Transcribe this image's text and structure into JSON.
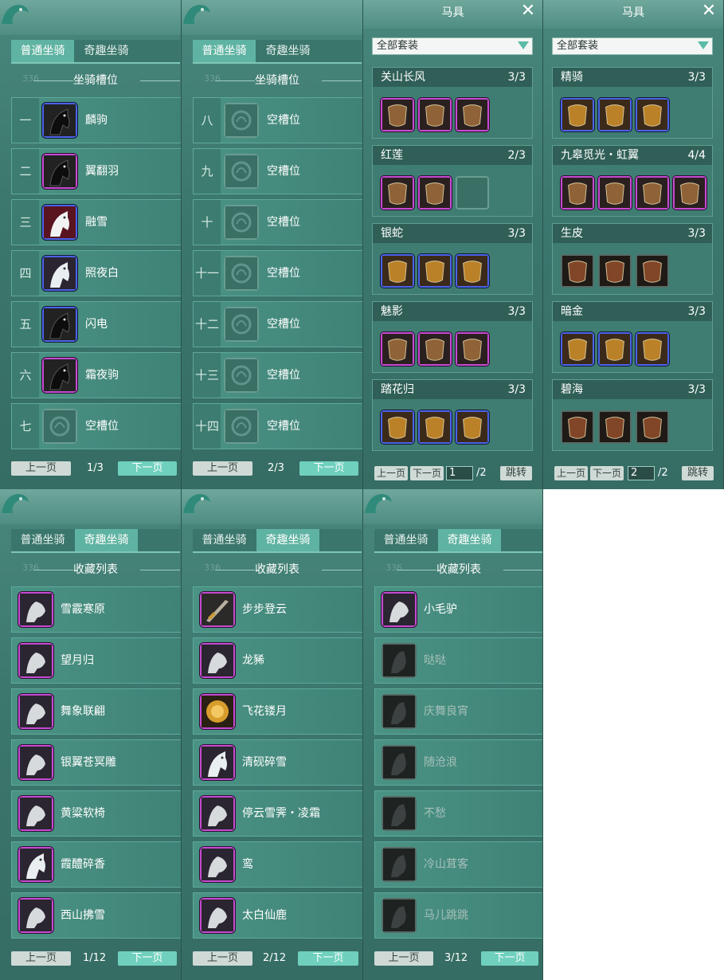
{
  "tabs": {
    "normal": "普通坐骑",
    "fancy": "奇趣坐骑"
  },
  "watermark": "336",
  "slots_section_title": "坐骑槽位",
  "collection_section_title": "收藏列表",
  "pager": {
    "prev": "上一页",
    "next": "下一页"
  },
  "colors": {
    "panel": "#3c786e",
    "tab_active": "#5fb3a2",
    "blue_quality": "#4a63e8",
    "purple_quality": "#c64ad2"
  },
  "slot_panels": [
    {
      "page": "1/3",
      "rows": [
        {
          "idx": "一",
          "name": "麟驹",
          "quality": "blue",
          "icon": "black-horse-icon"
        },
        {
          "idx": "二",
          "name": "翼翻羽",
          "quality": "purple",
          "icon": "black-horse-icon"
        },
        {
          "idx": "三",
          "name": "融雪",
          "quality": "blue",
          "icon": "white-horse-red-icon"
        },
        {
          "idx": "四",
          "name": "照夜白",
          "quality": "blue",
          "icon": "white-horse-icon"
        },
        {
          "idx": "五",
          "name": "闪电",
          "quality": "blue",
          "icon": "black-horse-icon"
        },
        {
          "idx": "六",
          "name": "霜夜驹",
          "quality": "purple",
          "icon": "black-horse-icon"
        },
        {
          "idx": "七",
          "name": "空槽位",
          "quality": "empty",
          "icon": "empty-slot-icon"
        }
      ]
    },
    {
      "page": "2/3",
      "rows": [
        {
          "idx": "八",
          "name": "空槽位",
          "quality": "empty",
          "icon": "empty-slot-icon"
        },
        {
          "idx": "九",
          "name": "空槽位",
          "quality": "empty",
          "icon": "empty-slot-icon"
        },
        {
          "idx": "十",
          "name": "空槽位",
          "quality": "empty",
          "icon": "empty-slot-icon"
        },
        {
          "idx": "十一",
          "name": "空槽位",
          "quality": "empty",
          "icon": "empty-slot-icon"
        },
        {
          "idx": "十二",
          "name": "空槽位",
          "quality": "empty",
          "icon": "empty-slot-icon"
        },
        {
          "idx": "十三",
          "name": "空槽位",
          "quality": "empty",
          "icon": "empty-slot-icon"
        },
        {
          "idx": "十四",
          "name": "空槽位",
          "quality": "empty",
          "icon": "empty-slot-icon"
        }
      ]
    }
  ],
  "gear": {
    "title": "马具",
    "filter": "全部套装",
    "jump": "跳转",
    "panels": [
      {
        "page_input": "1",
        "page_total": "/2",
        "sets": [
          {
            "name": "关山长风",
            "count": "3/3",
            "items": [
              "purple",
              "purple",
              "purple"
            ]
          },
          {
            "name": "红莲",
            "count": "2/3",
            "items": [
              "purple",
              "purple",
              "empty"
            ]
          },
          {
            "name": "银蛇",
            "count": "3/3",
            "items": [
              "blue",
              "blue",
              "blue"
            ]
          },
          {
            "name": "魅影",
            "count": "3/3",
            "items": [
              "purple",
              "purple",
              "purple"
            ]
          },
          {
            "name": "踏花归",
            "count": "3/3",
            "items": [
              "blue",
              "blue",
              "blue"
            ]
          }
        ]
      },
      {
        "page_input": "2",
        "page_total": "/2",
        "sets": [
          {
            "name": "精骑",
            "count": "3/3",
            "items": [
              "blue",
              "blue",
              "blue"
            ]
          },
          {
            "name": "九皋觅光・虹翼",
            "count": "4/4",
            "items": [
              "purple",
              "purple",
              "purple",
              "purple"
            ]
          },
          {
            "name": "生皮",
            "count": "3/3",
            "items": [
              "dark",
              "dark",
              "dark"
            ]
          },
          {
            "name": "暗金",
            "count": "3/3",
            "items": [
              "blue",
              "blue",
              "blue"
            ]
          },
          {
            "name": "碧海",
            "count": "3/3",
            "items": [
              "dark",
              "dark",
              "dark"
            ]
          }
        ]
      }
    ]
  },
  "collection_panels": [
    {
      "page": "1/12",
      "rows": [
        {
          "name": "雪霰寒原",
          "quality": "purple",
          "icon": "white-wolf-icon",
          "dim": false
        },
        {
          "name": "望月归",
          "quality": "purple",
          "icon": "moon-rabbit-icon",
          "dim": false
        },
        {
          "name": "舞象联翩",
          "quality": "purple",
          "icon": "elephant-icon",
          "dim": false
        },
        {
          "name": "银翼苍冥雕",
          "quality": "purple",
          "icon": "eagle-icon",
          "dim": false
        },
        {
          "name": "黄粱软椅",
          "quality": "purple",
          "icon": "chair-icon",
          "dim": false
        },
        {
          "name": "霞醴碎香",
          "quality": "purple",
          "icon": "white-horse-icon",
          "dim": false
        },
        {
          "name": "西山拂雪",
          "quality": "purple",
          "icon": "white-deer-icon",
          "dim": false
        }
      ]
    },
    {
      "page": "2/12",
      "rows": [
        {
          "name": "步步登云",
          "quality": "purple",
          "icon": "sword-icon",
          "dim": false
        },
        {
          "name": "龙豨",
          "quality": "purple",
          "icon": "boar-icon",
          "dim": false
        },
        {
          "name": "飞花镂月",
          "quality": "purple",
          "icon": "golden-orb-icon",
          "dim": false
        },
        {
          "name": "清砚碎雪",
          "quality": "purple",
          "icon": "white-horse-icon",
          "dim": false
        },
        {
          "name": "停云雪霁・凌霜",
          "quality": "purple",
          "icon": "dragon-icon",
          "dim": false
        },
        {
          "name": "鸾",
          "quality": "purple",
          "icon": "phoenix-icon",
          "dim": false
        },
        {
          "name": "太白仙鹿",
          "quality": "purple",
          "icon": "antler-deer-icon",
          "dim": false
        }
      ]
    },
    {
      "page": "3/12",
      "rows": [
        {
          "name": "小毛驴",
          "quality": "purple",
          "icon": "donkey-icon",
          "dim": false
        },
        {
          "name": "哒哒",
          "quality": "dark",
          "icon": "mount-silhouette-icon",
          "dim": true
        },
        {
          "name": "庆舞良宵",
          "quality": "dark",
          "icon": "mount-silhouette-icon",
          "dim": true
        },
        {
          "name": "随沧浪",
          "quality": "dark",
          "icon": "mount-silhouette-icon",
          "dim": true
        },
        {
          "name": "不愁",
          "quality": "dark",
          "icon": "mount-silhouette-icon",
          "dim": true
        },
        {
          "name": "冷山茸客",
          "quality": "dark",
          "icon": "mount-silhouette-icon",
          "dim": true
        },
        {
          "name": "马儿跳跳",
          "quality": "dark",
          "icon": "mount-silhouette-icon",
          "dim": true
        }
      ]
    }
  ]
}
